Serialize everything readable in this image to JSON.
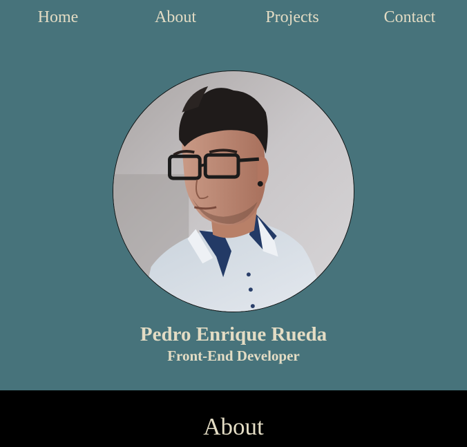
{
  "nav": {
    "items": [
      {
        "label": "Home"
      },
      {
        "label": "About"
      },
      {
        "label": "Projects"
      },
      {
        "label": "Contact"
      }
    ]
  },
  "hero": {
    "name": "Pedro Enrique Rueda",
    "role": "Front-End Developer"
  },
  "about": {
    "title": "About"
  },
  "colors": {
    "background": "#47737b",
    "text": "#e3dcc4",
    "section_dark": "#000000"
  }
}
